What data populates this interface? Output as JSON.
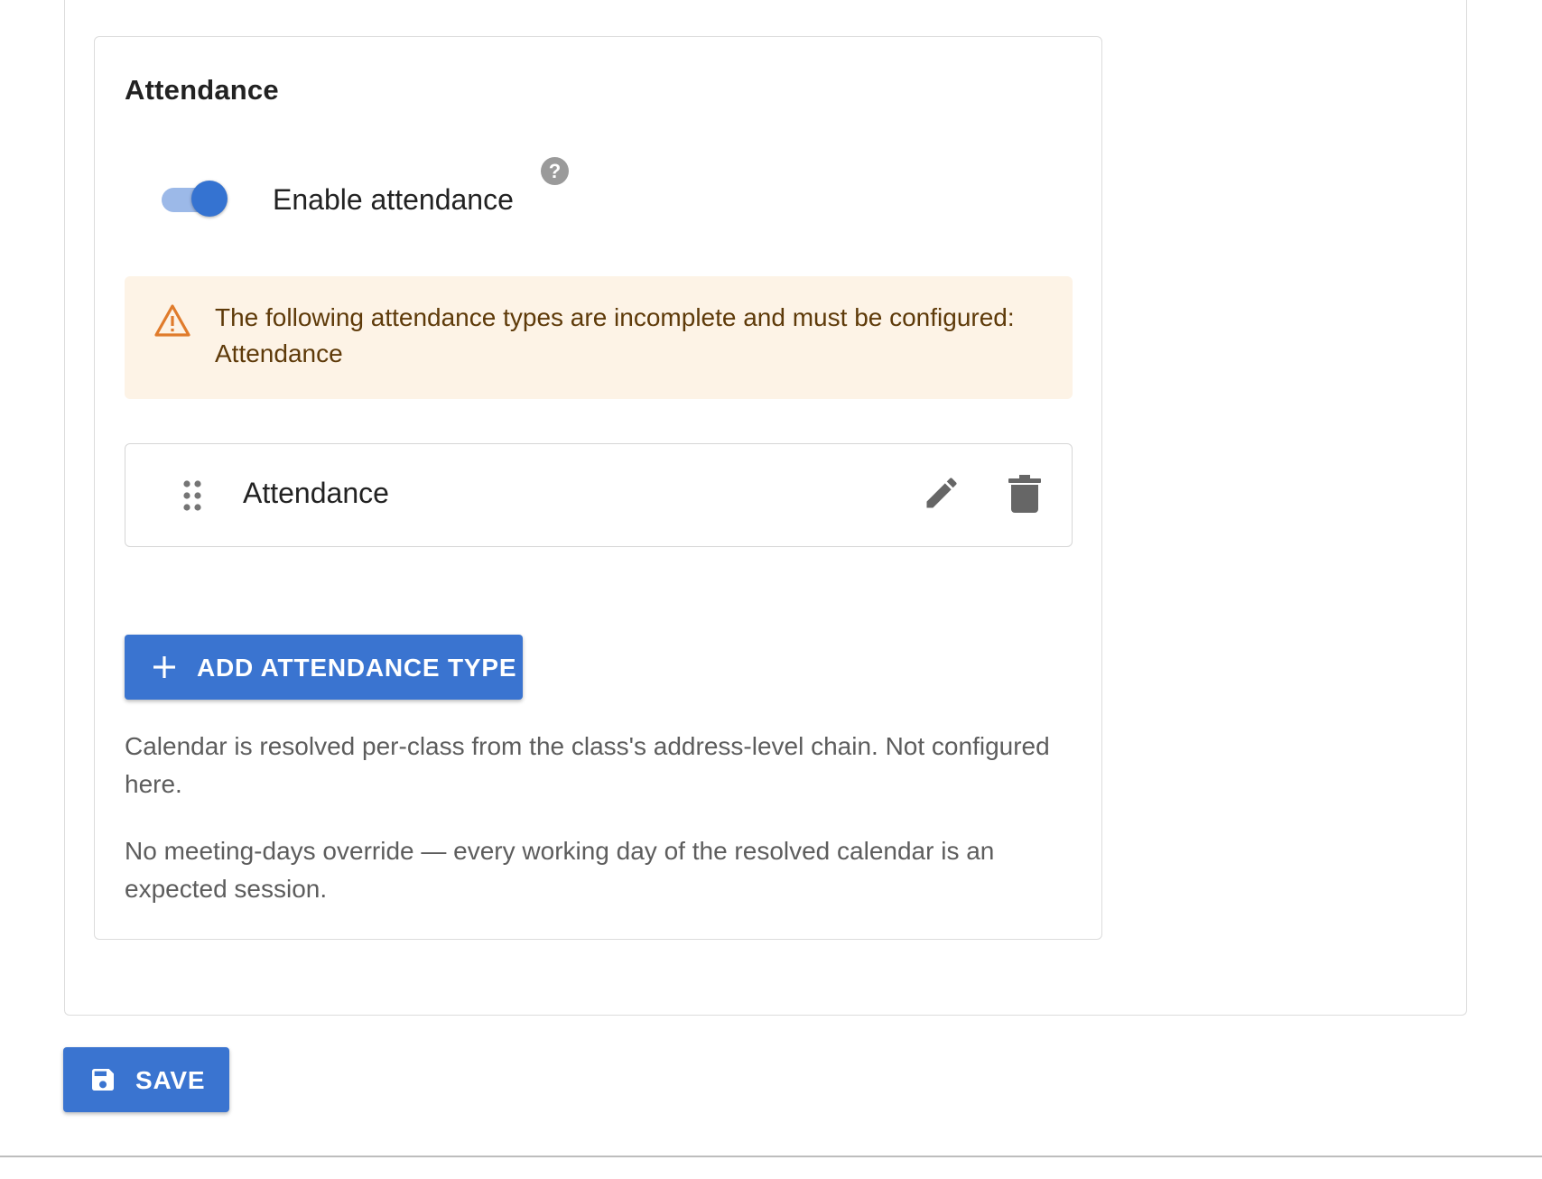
{
  "section": {
    "title": "Attendance",
    "enable_toggle": {
      "label": "Enable attendance",
      "checked": true,
      "help_icon": "question-mark"
    }
  },
  "warning": {
    "icon": "warning-triangle",
    "text": "The following attendance types are incomplete and must be configured: Attendance",
    "accent_color": "#e07b2b",
    "background_color": "#fdf3e6"
  },
  "attendance_types": [
    {
      "name": "Attendance",
      "icons": [
        "drag-handle",
        "edit-pencil",
        "delete-trash"
      ]
    }
  ],
  "add_button": {
    "label": "ADD ATTENDANCE TYPE",
    "icon": "plus"
  },
  "notes": [
    "Calendar is resolved per-class from the class's address-level chain. Not configured here.",
    "No meeting-days override — every working day of the resolved calendar is an expected session."
  ],
  "save_button": {
    "label": "SAVE",
    "icon": "floppy-disk"
  },
  "colors": {
    "primary": "#3a74d0",
    "toggle_track": "#9cb9e8"
  }
}
